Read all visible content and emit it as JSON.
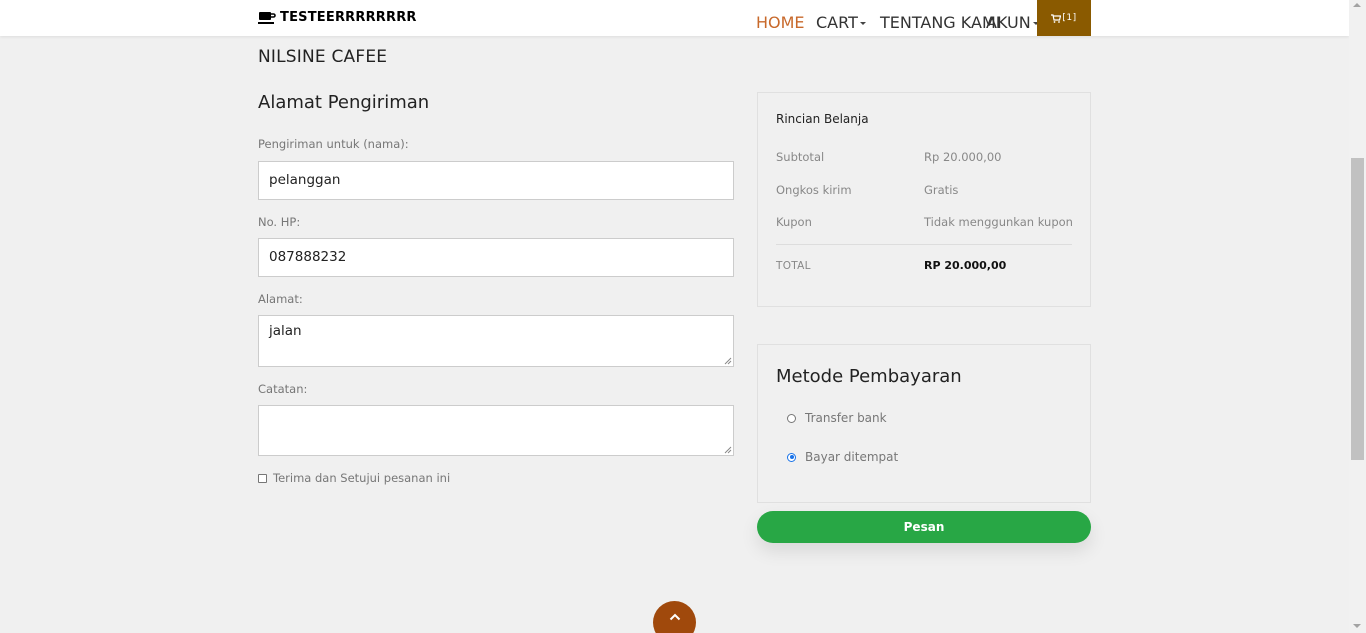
{
  "nav": {
    "brand": "TESTEERRRRRRRR",
    "items": [
      {
        "label": "HOME",
        "active": true
      },
      {
        "label": "CART",
        "dropdown": true
      },
      {
        "label": "TENTANG KAMI"
      },
      {
        "label": "AKUN",
        "dropdown": true
      }
    ],
    "cart_label": "[1]",
    "active_color": "#c8692b",
    "cart_color": "#8a5a00"
  },
  "page": {
    "shop_name": "NILSINE CAFEE",
    "section_title": "Alamat Pengiriman"
  },
  "form": {
    "name_label": "Pengiriman untuk (nama):",
    "name_value": "pelanggan",
    "phone_label": "No. HP:",
    "phone_value": "087888232",
    "address_label": "Alamat:",
    "address_value": "jalan",
    "notes_label": "Catatan:",
    "notes_value": "",
    "agree_label": "Terima dan Setujui pesanan ini",
    "agree_checked": false
  },
  "summary": {
    "title": "Rincian Belanja",
    "rows": [
      {
        "label": "Subtotal",
        "value": "Rp 20.000,00"
      },
      {
        "label": "Ongkos kirim",
        "value": "Gratis"
      },
      {
        "label": "Kupon",
        "value": "Tidak menggunkan kupon"
      }
    ],
    "total_label": "TOTAL",
    "total_value": "RP 20.000,00"
  },
  "payment": {
    "title": "Metode Pembayaran",
    "options": [
      {
        "label": "Transfer bank",
        "checked": false
      },
      {
        "label": "Bayar ditempat",
        "checked": true
      }
    ]
  },
  "order_button": {
    "label": "Pesan",
    "color": "#28a745"
  },
  "back_to_top": {
    "icon": "chevron-up-icon",
    "color": "#a0490c"
  }
}
